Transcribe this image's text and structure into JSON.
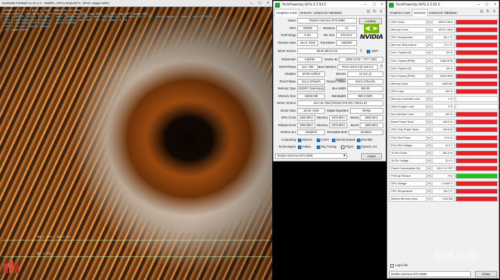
{
  "bench": {
    "title": "Geeks3D FurMark v1.31.1.0 - 1660Ps, GPU1 temp:60°C, GPU1 usage:100%",
    "osd_lines": [
      "FurMark v1.31.1.0 - Burn-in test, 2560x1440 (0X MSAA)",
      "Frames:23049 - time:00:00:58 - FPS:1660 (min:0, max:1876, avg:1667) - [ GPU1 temp:60°C usage:100%  ]",
      "> GPU 1 (NVIDIA GeForce RTX 5080) - core: 2805MHz/60°C/100%, mem: 15002MHz/16%, GPU power: 95.7% TDP, limits:[power:1, temp:0, volt:0, OV:0]",
      "> GPU 2 (AMD Radeon(TM) Graphics) - core: 2200MHz, mem: 0MHz, GPU chip power: 0.0 W",
      "> GPU 3 (AMD Radeon(TM) Graphics) - core: 2200MHz",
      "> GPU 4 (Virtual Display Adapter)",
      "- F1: toggle help"
    ],
    "graph_labels": [
      "GPU 1: 60°C - GPU 2: 0°C",
      "GPU 1: 95%"
    ]
  },
  "gpuz_main": {
    "title": "TechPowerUp GPU-Z 2.53.0",
    "tabs": [
      "Graphics Card",
      "Sensors",
      "Advanced",
      "Validation"
    ],
    "lookup_label": "Lookup",
    "uefi_label": "UEFI",
    "fields": {
      "name": {
        "label": "Name",
        "value": "NVIDIA GeForce RTX 5080"
      },
      "gpu": {
        "label": "GPU",
        "value": "GB203"
      },
      "revision": {
        "label": "Revision",
        "value": "A1"
      },
      "technology": {
        "label": "Technology",
        "value": "5 nm"
      },
      "die_size": {
        "label": "Die Size",
        "value": "378 mm²"
      },
      "release_date": {
        "label": "Release Date",
        "value": "Jan 6, 2025"
      },
      "transistors": {
        "label": "Transistors",
        "value": "45600M"
      },
      "bios": {
        "label": "BIOS Version",
        "value": "98.03.3B.C0.C5"
      },
      "subvendor": {
        "label": "Subvendor",
        "value": "Colorful"
      },
      "device_id": {
        "label": "Device ID",
        "value": "10DE 2C02 - 7377 1301"
      },
      "rops": {
        "label": "ROPs/TMUs",
        "value": "112 / 336"
      },
      "bus_interface": {
        "label": "Bus Interface",
        "value": "PCIe x16 5.0 @ x16 5.0"
      },
      "shaders": {
        "label": "Shaders",
        "value": "10752 Unified"
      },
      "directx": {
        "label": "DirectX Support",
        "value": "12 (12_2)"
      },
      "pixel_fillrate": {
        "label": "Pixel Fillrate",
        "value": "314.2 GPixel/s"
      },
      "texture_fillrate": {
        "label": "Texture Fillrate",
        "value": "942.5 GTexel/s"
      },
      "memory_type": {
        "label": "Memory Type",
        "value": "GDDR7 (Samsung)"
      },
      "bus_width": {
        "label": "Bus Width",
        "value": "256 bit"
      },
      "memory_size": {
        "label": "Memory Size",
        "value": "16384 MB"
      },
      "bandwidth": {
        "label": "Bandwidth",
        "value": "960.0 GB/s"
      },
      "driver_version": {
        "label": "Driver Version",
        "value": "32.0.15.7094 (NVIDIA 570.94) / Win11 64"
      },
      "driver_date": {
        "label": "Driver Date",
        "value": "Jul 02, 2025"
      },
      "digital_signature": {
        "label": "Digital Signature",
        "value": "WHQL"
      },
      "gpu_clock": {
        "label": "GPU Clock",
        "value": "2295 MHz",
        "mem_label": "Memory",
        "mem_value": "1875 MHz",
        "boost_label": "Boost",
        "boost_value": "2655 MHz"
      },
      "default_clock": {
        "label": "Default Clock",
        "value": "2295 MHz",
        "mem_label": "Memory",
        "mem_value": "1875 MHz",
        "boost_label": "Boost",
        "boost_value": "2655 MHz"
      },
      "sli": {
        "label": "NVIDIA SLI",
        "value": "Disabled",
        "rebar_label": "Resizable BAR",
        "rebar_value": "Enabled"
      }
    },
    "computing": {
      "label": "Computing",
      "items": [
        "OpenCL",
        "CUDA",
        "DirectCompute",
        "DirectML"
      ]
    },
    "technologies": {
      "label": "Technologies",
      "items": [
        "Vulkan",
        "Ray Tracing",
        "PhysX",
        "OpenGL 4.6"
      ]
    },
    "gpu_select": "NVIDIA GeForce RTX 5080",
    "close_label": "Close"
  },
  "gpuz_sensors": {
    "title": "TechPowerUp GPU-Z 2.53.0",
    "tabs": [
      "Graphics Card",
      "Sensors",
      "Advanced",
      "Validation"
    ],
    "colors": {
      "bar": "#e8202a",
      "green": "#20c020"
    },
    "rows": [
      {
        "name": "GPU Clock",
        "value": "2655.0 MHz",
        "fill": 0.98,
        "color": "red"
      },
      {
        "name": "Memory Clock",
        "value": "1875.1 MHz",
        "fill": 0.98,
        "color": "red"
      },
      {
        "name": "GPU Temperature",
        "value": "60.2 °C",
        "fill": 0.98,
        "color": "red"
      },
      {
        "name": "Memory Temperature",
        "value": "72.0 °C",
        "fill": 0.98,
        "color": "red"
      },
      {
        "name": "Fan 1 Speed (%)",
        "value": "63 %",
        "fill": 0.98,
        "color": "red"
      },
      {
        "name": "Fan 1 Speed (RPM)",
        "value": "1958 RPM",
        "fill": 0.98,
        "color": "red"
      },
      {
        "name": "Fan 2 Speed (%)",
        "value": "63 %",
        "fill": 0.98,
        "color": "red"
      },
      {
        "name": "Fan 2 Speed (RPM)",
        "value": "2240 RPM",
        "fill": 0.98,
        "color": "red"
      },
      {
        "name": "Memory Used",
        "value": "1662 MB",
        "fill": 0.98,
        "color": "red"
      },
      {
        "name": "GPU Load",
        "value": "100 %",
        "fill": 0.98,
        "color": "red"
      },
      {
        "name": "Memory Controller Load",
        "value": "0 %",
        "fill": 0.0,
        "color": "red"
      },
      {
        "name": "Video Engine Load",
        "value": "0 %",
        "fill": 0.0,
        "color": "red"
      },
      {
        "name": "Bus Interface Load",
        "value": "100 %",
        "fill": 0.98,
        "color": "red"
      },
      {
        "name": "Board Power Draw",
        "value": "408.3 W",
        "fill": 0.98,
        "color": "red"
      },
      {
        "name": "GPU Chip Power Draw",
        "value": "153.8 W",
        "fill": 0.98,
        "color": "red"
      },
      {
        "name": "PCIe Slot Power",
        "value": "14.0 W",
        "fill": 0.98,
        "color": "red"
      },
      {
        "name": "PCIe Slot Voltage",
        "value": "11.9 V",
        "fill": 0.98,
        "color": "red"
      },
      {
        "name": "16-Pin Power",
        "value": "361.5 W",
        "fill": 0.98,
        "color": "red"
      },
      {
        "name": "16-Pin Voltage",
        "value": "11.9 V",
        "fill": 0.98,
        "color": "red"
      },
      {
        "name": "Power Consumption (%)",
        "value": "100.1 % TDP",
        "fill": 0.98,
        "color": "red"
      },
      {
        "name": "PerfCap Reason",
        "value": "Pwr",
        "fill": 0.98,
        "color": "green"
      },
      {
        "name": "GPU Voltage",
        "value": "0.9400 V",
        "fill": 0.98,
        "color": "red"
      },
      {
        "name": "CPU Temperature",
        "value": "69.0 °C",
        "fill": 0.98,
        "color": "red"
      },
      {
        "name": "System Memory Used",
        "value": "7334 MB",
        "fill": 0.98,
        "color": "red"
      }
    ],
    "log_label": "Log to file",
    "gpu_select": "NVIDIA GeForce RTX 5080",
    "close_label": "Close"
  },
  "watermark": "新浪众测"
}
